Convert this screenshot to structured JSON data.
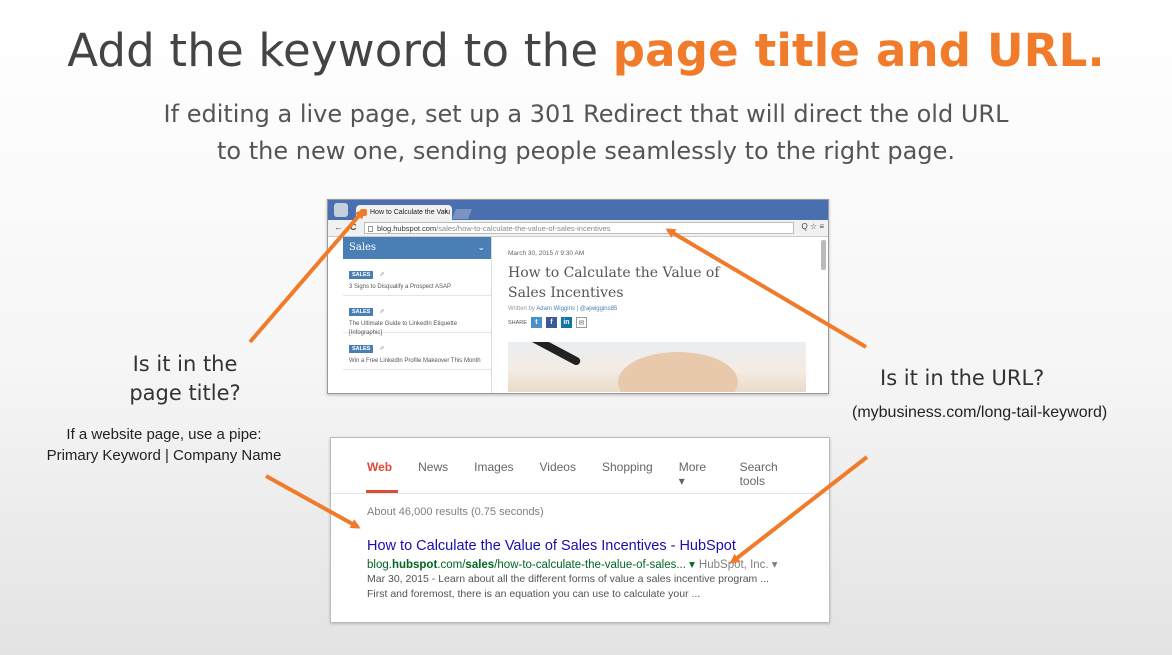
{
  "slide": {
    "title_plain": "Add the keyword to the ",
    "title_accent": "page title and URL.",
    "subtitle_line1": "If editing a live page, set up a 301 Redirect that will direct the old URL",
    "subtitle_line2": "to the new one, sending people seamlessly to the right page.",
    "accent_color": "#f07c2b"
  },
  "labels": {
    "q_title_line1": "Is it in the",
    "q_title_line2": "page title?",
    "pipe_line1": "If a website page, use a pipe:",
    "pipe_line2": "Primary Keyword | Company Name",
    "q_url": "Is it in the URL?",
    "url_example": "(mybusiness.com/long-tail-keyword)"
  },
  "browser": {
    "tab_title": "How to Calculate the Valu",
    "tab_close": "×",
    "url_host": "blog.hubspot.com",
    "url_path": "/sales/how-to-calculate-the-value-of-sales-incentives",
    "back": "←",
    "reload": "C",
    "tools": "Q ☆ ≡",
    "sidebar_heading": "Sales",
    "sidebar_chevron": "⌄",
    "sidebar_items": [
      {
        "badge": "SALES",
        "text": "3 Signs to Disqualify a Prospect ASAP"
      },
      {
        "badge": "SALES",
        "text": "The Ultimate Guide to LinkedIn Etiquette [Infographic]"
      },
      {
        "badge": "SALES",
        "text": "Win a Free LinkedIn Profile Makeover This Month"
      }
    ],
    "article_date": "March 30, 2015 // 9:30 AM",
    "article_title_line1": "How to Calculate the Value of",
    "article_title_line2": "Sales Incentives",
    "written_by": "Written by ",
    "author": "Adam Wiggins | @ajwiggins85",
    "share_label": "SHARE"
  },
  "serp": {
    "tabs": [
      "Web",
      "News",
      "Images",
      "Videos",
      "Shopping",
      "More ▾",
      "Search tools"
    ],
    "results_count": "About 46,000 results (0.75 seconds)",
    "result_title": "How to Calculate the Value of Sales Incentives - HubSpot",
    "result_url_host_pre": "blog.",
    "result_url_host_bold": "hubspot",
    "result_url_mid": ".com/",
    "result_url_bold2": "sales",
    "result_url_path": "/how-to-calculate-the-value-of-sales... ▾",
    "result_company": "HubSpot, Inc. ▾",
    "snippet_line1": "Mar 30, 2015 - Learn about all the different forms of value a sales incentive program ...",
    "snippet_line2": "First and foremost, there is an equation you can use to calculate your ..."
  }
}
